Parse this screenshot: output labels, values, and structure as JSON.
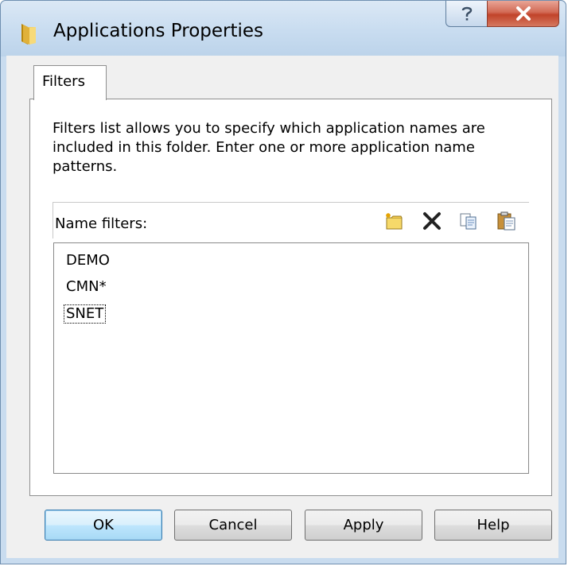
{
  "window": {
    "title": "Applications Properties",
    "titlebar_buttons": {
      "help": "?",
      "close": "X"
    }
  },
  "tabs": [
    {
      "label": "Filters",
      "selected": true
    }
  ],
  "filters": {
    "description": "Filters list allows you to specify which application names are included in this folder.  Enter one or more application name patterns.",
    "list_label": "Name filters:",
    "toolbar": [
      "new-icon",
      "delete-icon",
      "copy-icon",
      "paste-icon"
    ],
    "items": [
      "DEMO",
      "CMN*",
      "SNET"
    ],
    "focused_item": "SNET"
  },
  "buttons": {
    "ok": "OK",
    "cancel": "Cancel",
    "apply": "Apply",
    "help": "Help"
  },
  "colors": {
    "titlebar": "#c8dcf0",
    "close_button": "#c1432a",
    "default_button_border": "#3c7fb1",
    "dialog_background": "#f0f0f0"
  }
}
